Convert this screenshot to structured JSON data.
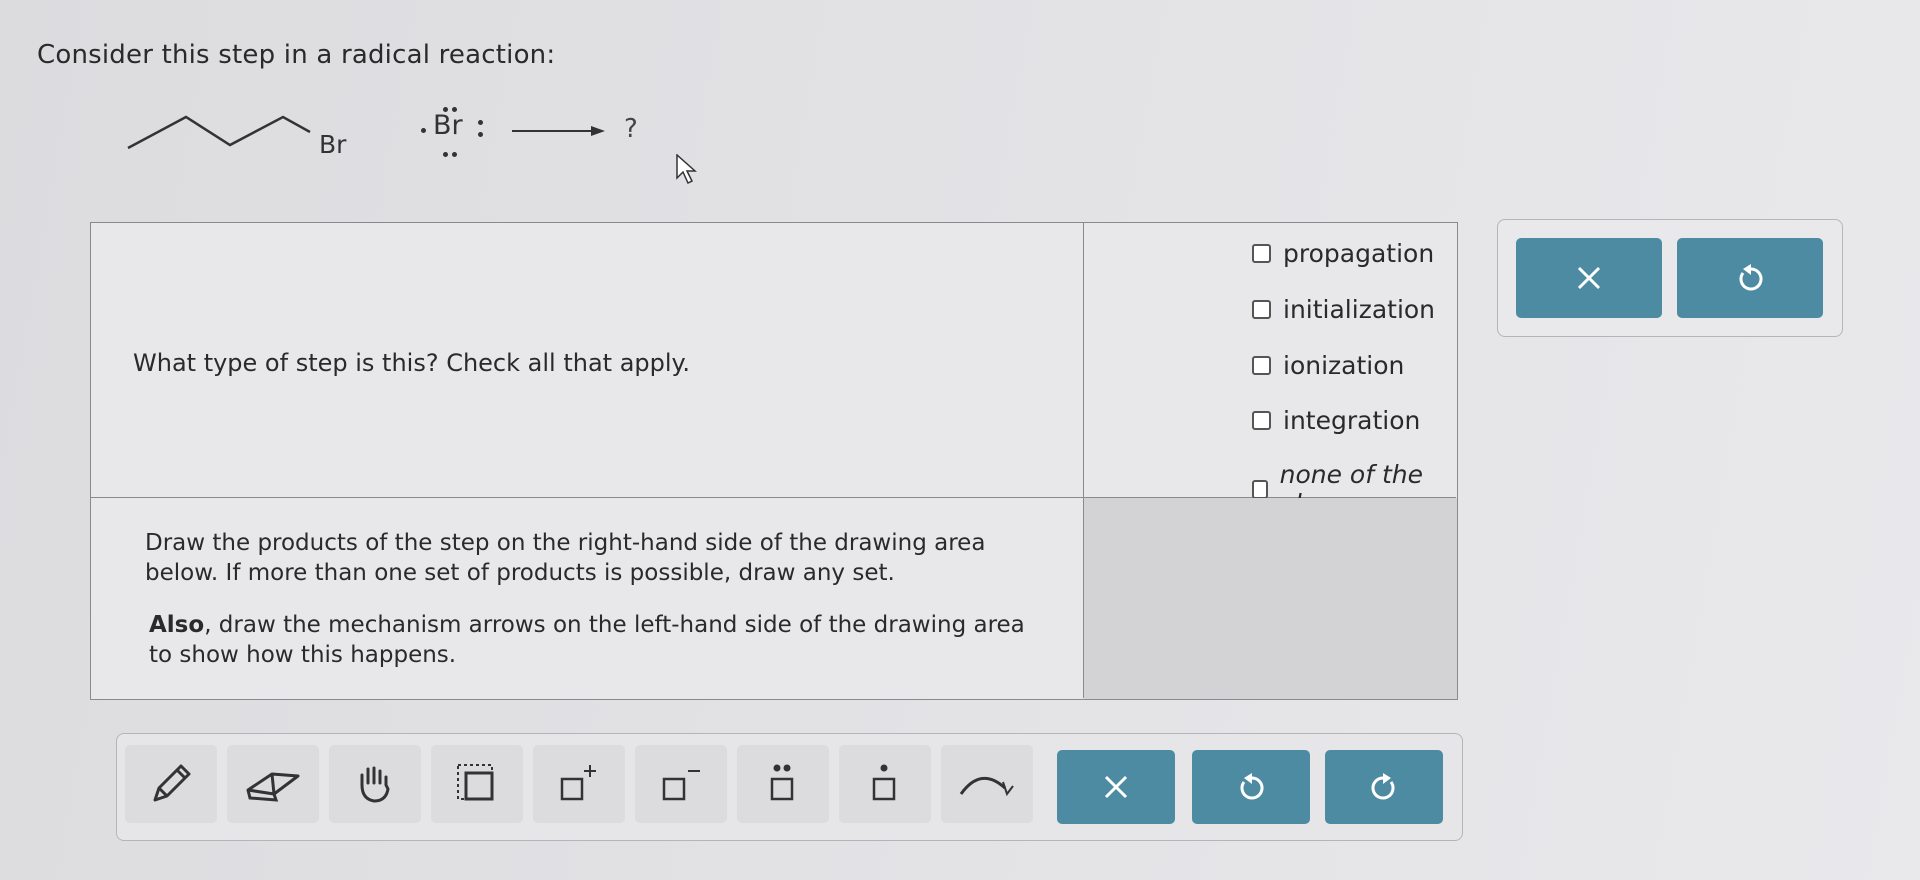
{
  "question": "Consider this step in a radical reaction:",
  "reaction": {
    "reactant_label": "Br",
    "radical_label": "Br",
    "product": "?"
  },
  "table": {
    "q1": "What type of step is this? Check all that apply.",
    "options": [
      "propagation",
      "initialization",
      "ionization",
      "integration",
      "none of the above"
    ],
    "q2_line1": "Draw the products of the step on the right-hand side of the drawing area below. If more than one set of products is possible, draw any set.",
    "q2_bold": "Also",
    "q2_line2": ", draw the mechanism arrows on the left-hand side of the drawing area to show how this happens."
  },
  "side_panel": {
    "clear_icon": "close-icon",
    "undo_icon": "undo-icon"
  },
  "toolbar": {
    "tools": [
      "pencil-icon",
      "eraser-icon",
      "hand-icon",
      "selection-icon",
      "positive-charge-icon",
      "negative-charge-icon",
      "lone-pair-icon",
      "single-electron-icon",
      "curved-arrow-icon"
    ],
    "clear_icon": "close-icon",
    "undo_icon": "undo-icon",
    "redo_icon": "redo-icon"
  },
  "colors": {
    "accent": "#4d8ba3",
    "background": "#e2e2e5",
    "border": "#8a8a8a"
  }
}
